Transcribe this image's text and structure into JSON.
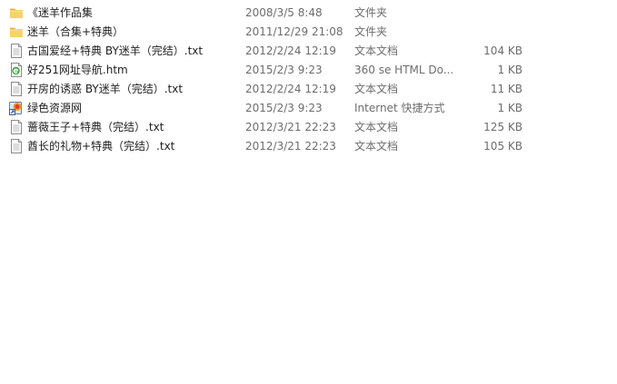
{
  "files": [
    {
      "name": "《迷羊作品集",
      "date": "2008/3/5 8:48",
      "type": "文件夹",
      "size": "",
      "icon": "folder-icon"
    },
    {
      "name": "迷羊（合集+特典）",
      "date": "2011/12/29 21:08",
      "type": "文件夹",
      "size": "",
      "icon": "folder-icon"
    },
    {
      "name": "古国爱经+特典 BY迷羊（完结）.txt",
      "date": "2012/2/24 12:19",
      "type": "文本文档",
      "size": "104 KB",
      "icon": "text-file-icon"
    },
    {
      "name": "好251网址导航.htm",
      "date": "2015/2/3 9:23",
      "type": "360 se HTML Do...",
      "size": "1 KB",
      "icon": "html-file-icon"
    },
    {
      "name": "开房的诱惑 BY迷羊（完结）.txt",
      "date": "2012/2/24 12:19",
      "type": "文本文档",
      "size": "11 KB",
      "icon": "text-file-icon"
    },
    {
      "name": "绿色资源网",
      "date": "2015/2/3 9:23",
      "type": "Internet 快捷方式",
      "size": "1 KB",
      "icon": "internet-shortcut-icon"
    },
    {
      "name": "蔷薇王子+特典（完结）.txt",
      "date": "2012/3/21 22:23",
      "type": "文本文档",
      "size": "125 KB",
      "icon": "text-file-icon"
    },
    {
      "name": "酋长的礼物+特典（完结）.txt",
      "date": "2012/3/21 22:23",
      "type": "文本文档",
      "size": "105 KB",
      "icon": "text-file-icon"
    }
  ]
}
